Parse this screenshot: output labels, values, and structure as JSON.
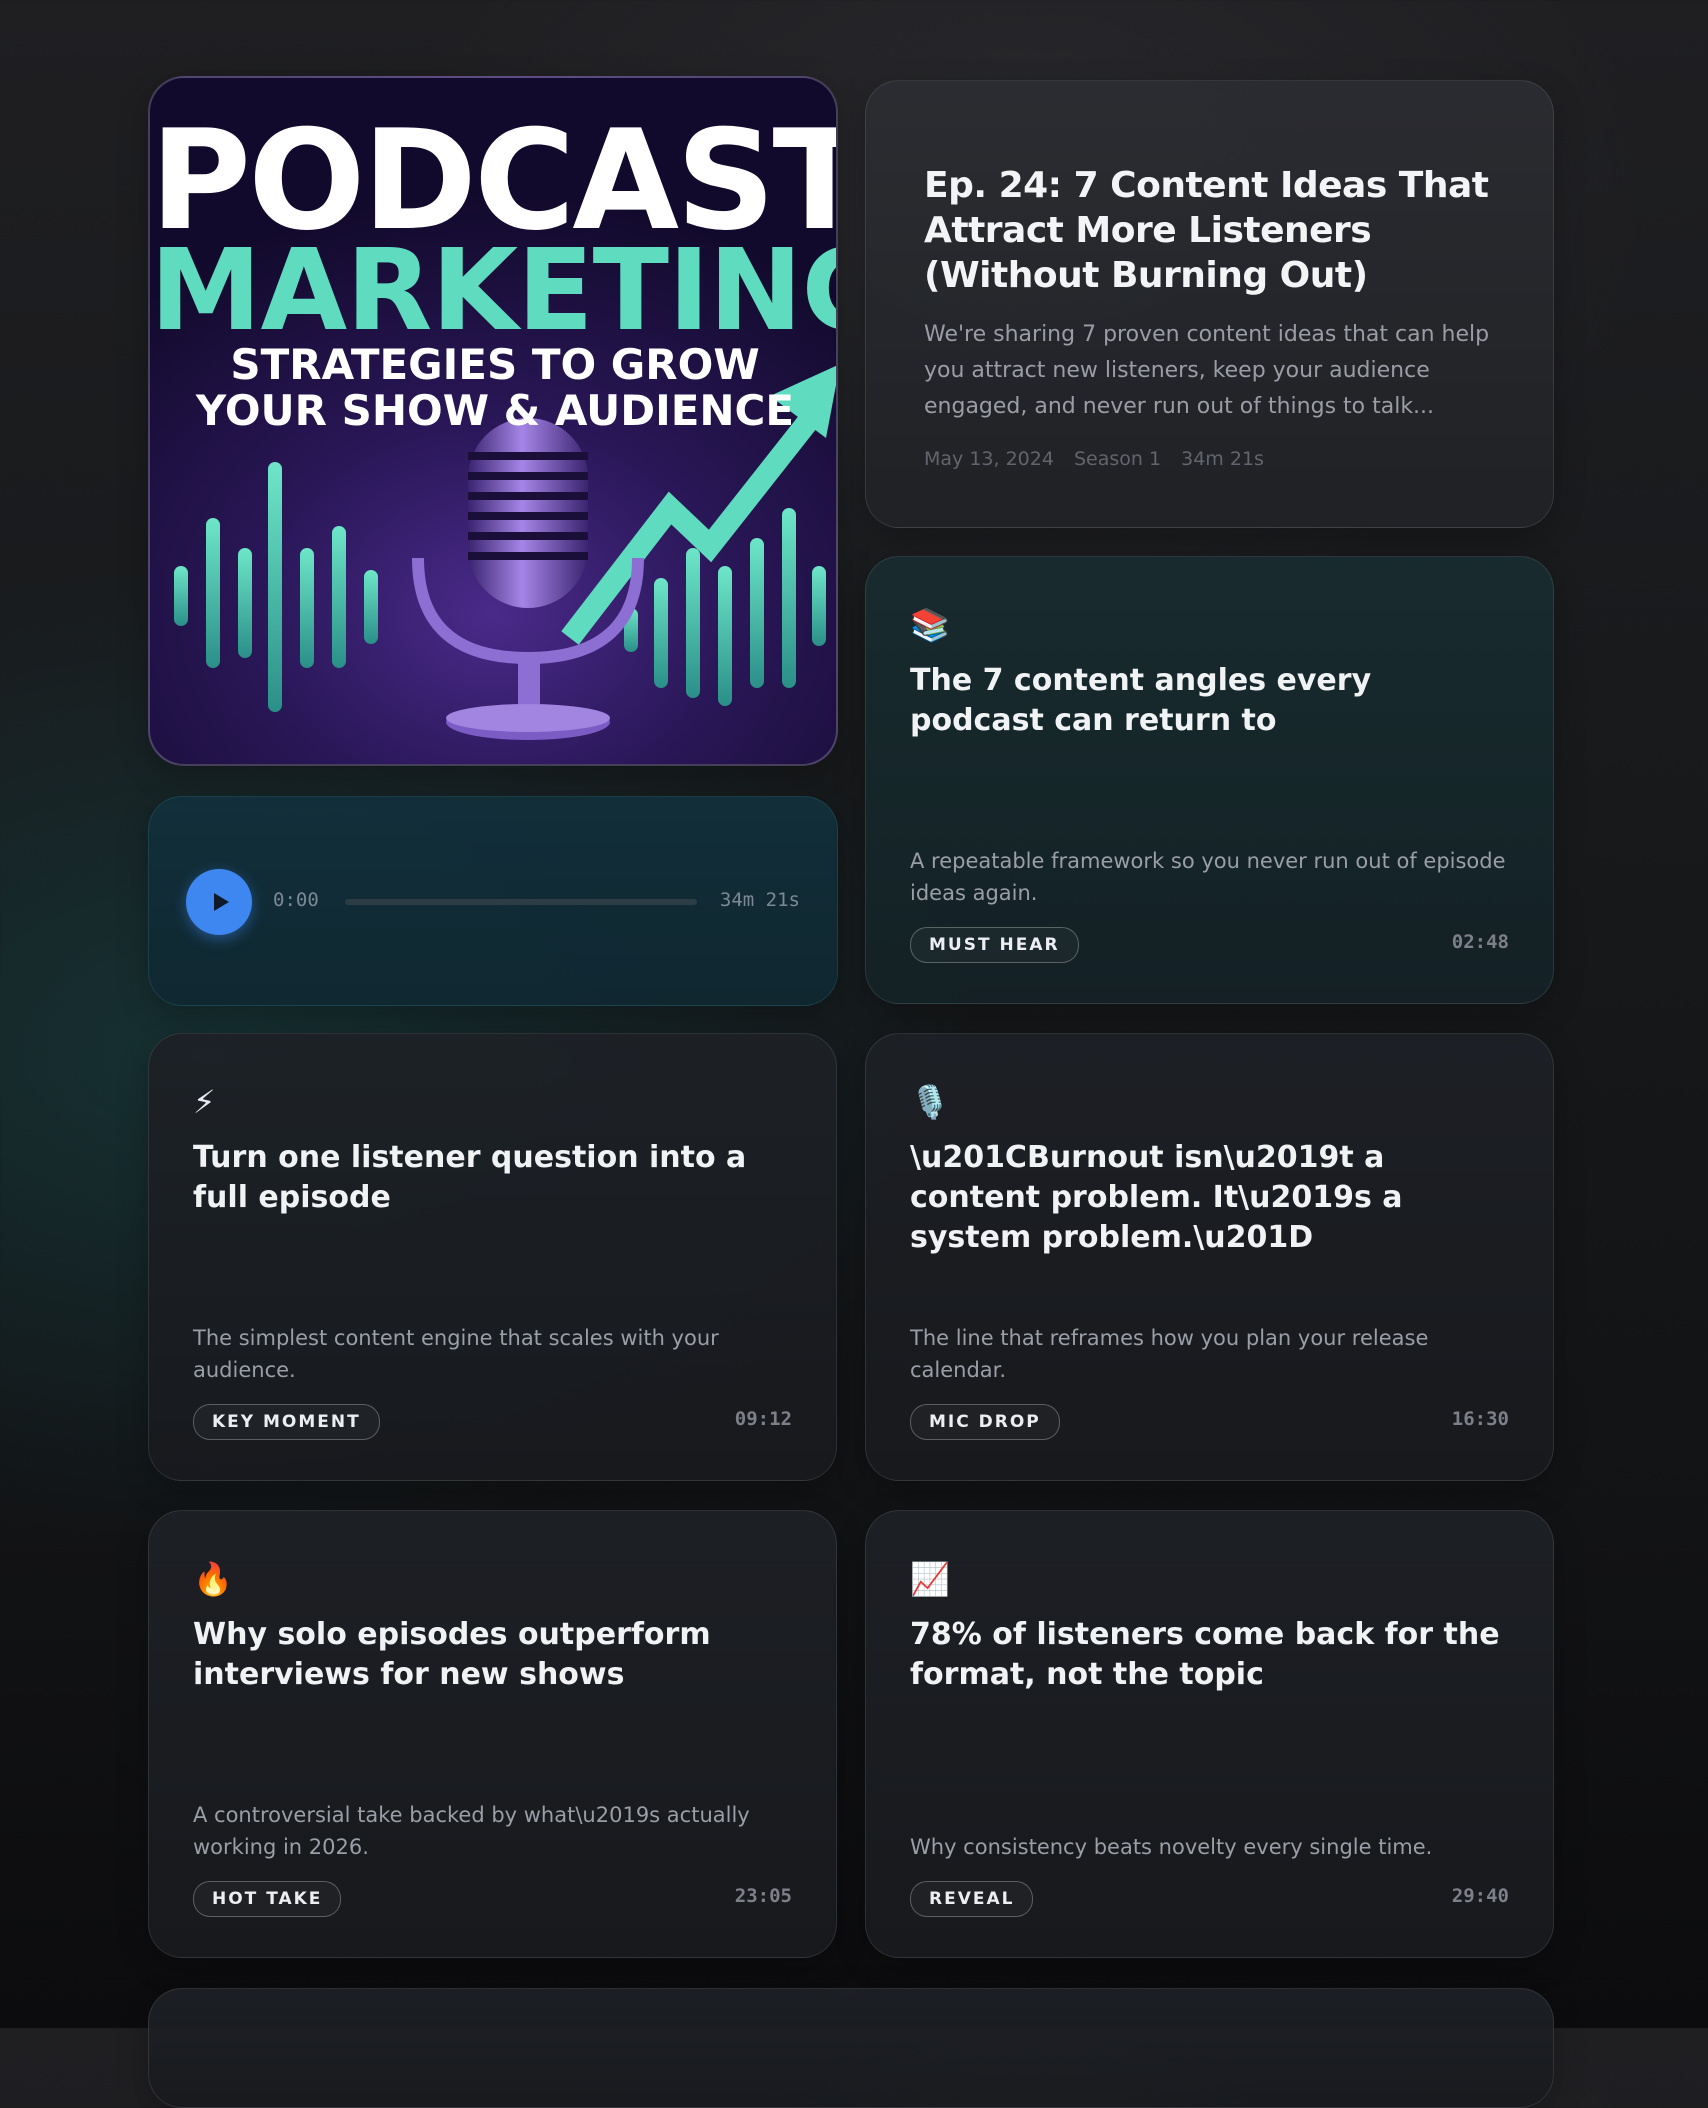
{
  "artwork": {
    "line1": "PODCAST",
    "line2": "MARKETING",
    "line3": "STRATEGIES TO GROW",
    "line4": "YOUR SHOW & AUDIENCE"
  },
  "player": {
    "play_icon": "play-icon",
    "current_time": "0:00",
    "total_time": "34m 21s",
    "progress": 0,
    "accent": "#3e86f0"
  },
  "episode": {
    "title": "Ep. 24: 7 Content Ideas That Attract More Listeners (Without Burning Out)",
    "description": "We're sharing 7 proven content ideas that can help you attract new listeners, keep your audience engaged, and never run out of things to talk...",
    "date": "May 13, 2024",
    "season": "Season 1",
    "duration": "34m 21s"
  },
  "highlights": [
    {
      "emoji": "📚",
      "title": "The 7 content angles every podcast can return to",
      "subtitle": "A repeatable framework so you never run out of episode ideas again.",
      "badge": "MUST HEAR",
      "timestamp": "02:48"
    },
    {
      "emoji": "⚡",
      "title": "Turn one listener question into a full episode",
      "subtitle": "The simplest content engine that scales with your audience.",
      "badge": "KEY MOMENT",
      "timestamp": "09:12"
    },
    {
      "emoji": "🎙️",
      "title": "\\u201CBurnout isn\\u2019t a content problem. It\\u2019s a system problem.\\u201D",
      "subtitle": "The line that reframes how you plan your release calendar.",
      "badge": "MIC DROP",
      "timestamp": "16:30"
    },
    {
      "emoji": "🔥",
      "title": "Why solo episodes outperform interviews for new shows",
      "subtitle": "A controversial take backed by what\\u2019s actually working in 2026.",
      "badge": "HOT TAKE",
      "timestamp": "23:05"
    },
    {
      "emoji": "📈",
      "title": "78% of listeners come back for the format, not the topic",
      "subtitle": "Why consistency beats novelty every single time.",
      "badge": "REVEAL",
      "timestamp": "29:40"
    }
  ]
}
